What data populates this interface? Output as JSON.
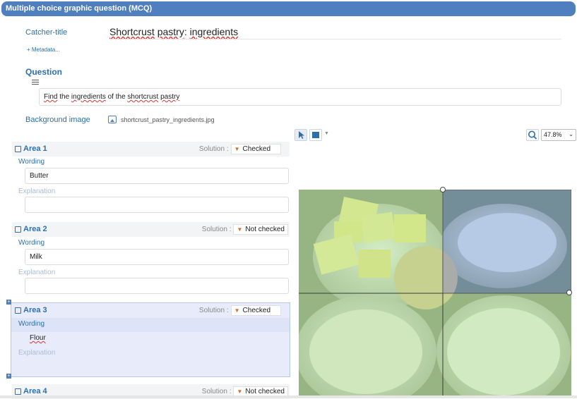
{
  "title": "Multiple choice graphic question (MCQ)",
  "catcher": {
    "label": "Catcher-title",
    "value_words": [
      "Shortcrust",
      "pastry",
      ": ",
      "ingredients"
    ]
  },
  "metadata_link": "+ Metadata...",
  "question": {
    "label": "Question",
    "text_parts": [
      {
        "t": "Find",
        "err": true
      },
      {
        "t": " the ",
        "err": false
      },
      {
        "t": "ingredients",
        "err": true
      },
      {
        "t": " of the ",
        "err": false
      },
      {
        "t": "shortcrust",
        "err": true
      },
      {
        "t": " ",
        "err": false
      },
      {
        "t": "pastry",
        "err": true
      }
    ]
  },
  "background_image": {
    "label": "Background image",
    "file": "shortcrust_pastry_ingredients.jpg"
  },
  "solution_label": "Solution :",
  "wording_label": "Wording",
  "explanation_label": "Explanation",
  "areas": [
    {
      "title": "Area 1",
      "solution": "Checked",
      "wording": "Butter",
      "explanation": ""
    },
    {
      "title": "Area 2",
      "solution": "Not checked",
      "wording": "Milk",
      "explanation": ""
    },
    {
      "title": "Area 3",
      "solution": "Checked",
      "wording": "Flour",
      "explanation": ""
    },
    {
      "title": "Area 4",
      "solution": "Not checked"
    }
  ],
  "zoom": "47.8%",
  "colors": {
    "accent": "#4f7fbf",
    "label_blue": "#2c6fad",
    "selection_blue": "#7a9fd6",
    "overlay_green": "#b6e3a0"
  }
}
